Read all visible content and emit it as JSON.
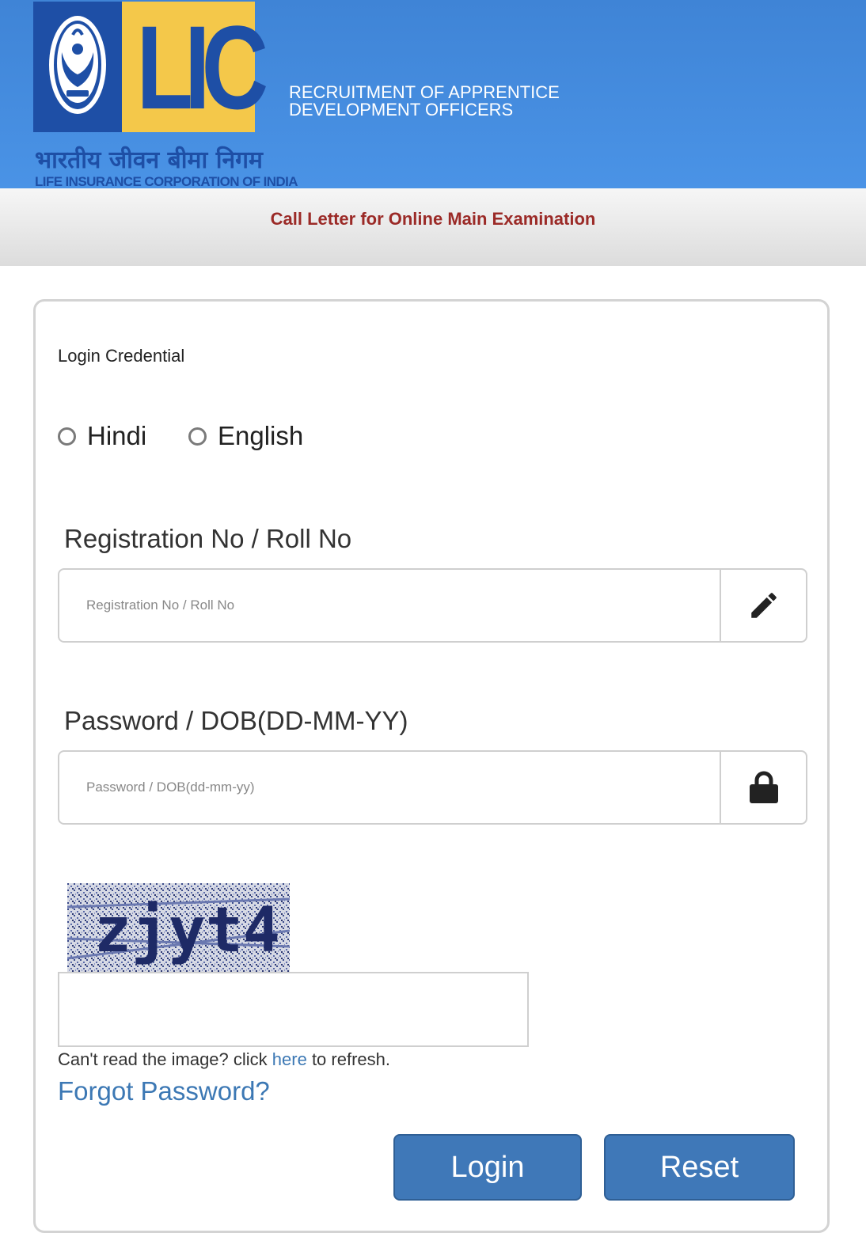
{
  "header": {
    "logo_text": "LIC",
    "logo_hindi": "भारतीय जीवन बीमा निगम",
    "logo_english": "LIFE INSURANCE CORPORATION OF INDIA",
    "title_line1": "RECRUITMENT OF APPRENTICE",
    "title_line2": "DEVELOPMENT OFFICERS"
  },
  "subheader": {
    "title": "Call Letter for Online Main Examination"
  },
  "login": {
    "heading": "Login Credential",
    "languages": [
      "Hindi",
      "English"
    ],
    "registration": {
      "label": "Registration No / Roll No",
      "placeholder": "Registration No / Roll No",
      "icon": "pencil-icon"
    },
    "password": {
      "label": "Password / DOB(DD-MM-YY)",
      "placeholder": "Password / DOB(dd-mm-yy)",
      "icon": "lock-icon"
    },
    "captcha": {
      "text": "zjyt4",
      "help_prefix": "Can't read the image? click ",
      "help_link": "here",
      "help_suffix": " to refresh."
    },
    "forgot_password": "Forgot Password?",
    "buttons": {
      "login": "Login",
      "reset": "Reset"
    }
  },
  "colors": {
    "header_blue": "#4a93e6",
    "logo_yellow": "#f4c84a",
    "logo_blue": "#1e4fa6",
    "subheader_text": "#9b2a27",
    "button_blue": "#3f78b8",
    "link_blue": "#3c78b4"
  }
}
